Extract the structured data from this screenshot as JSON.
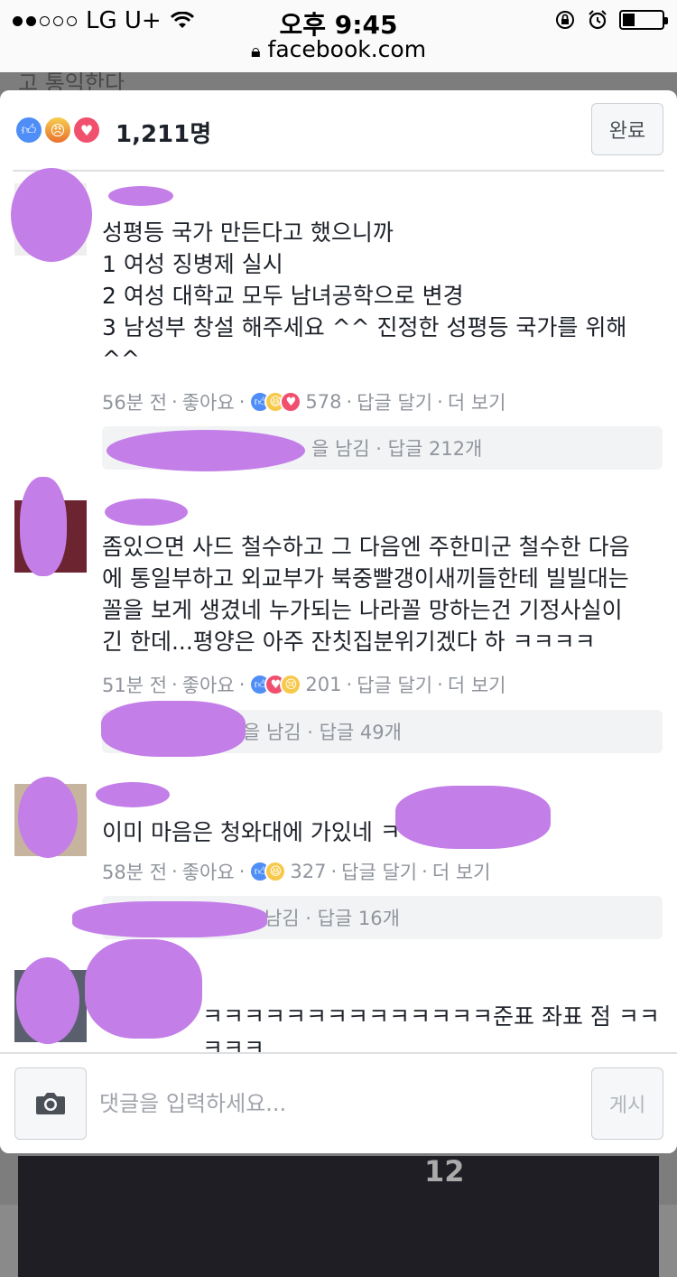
{
  "status_bar": {
    "carrier": "LG U+",
    "time": "오후 9:45",
    "url": "facebook.com",
    "battery_level": 0.3
  },
  "background_page": {
    "top_text": "고 통익한다",
    "photo_number": "12"
  },
  "header": {
    "reaction_icons": [
      "like-icon",
      "angry-icon",
      "love-icon"
    ],
    "reaction_count": "1,211명",
    "done_label": "완료"
  },
  "comments": [
    {
      "text": "성평등 국가 만든다고 했으니까\n1 여성 징병제 실시\n2 여성 대학교 모두 남녀공학으로 변경\n3 남성부 창설 해주세요 ^^ 진정한 성평등 국가를 위해\n^^",
      "time": "56분 전",
      "like": "좋아요",
      "reactions": [
        "like",
        "haha",
        "love"
      ],
      "reaction_count": "578",
      "reply": "답글 달기",
      "more": "더 보기",
      "replies_summary": "을 남김 · 답글 212개"
    },
    {
      "text": "좀있으면 사드 철수하고 그 다음엔 주한미군 철수한 다음\n에 통일부하고 외교부가 북중빨갱이새끼들한테 빌빌대는\n꼴을 보게 생겼네 누가되는 나라꼴 망하는건 기정사실이\n긴 한데...평양은 아주 잔칫집분위기겠다 하 ㅋㅋㅋㅋ",
      "time": "51분 전",
      "like": "좋아요",
      "reactions": [
        "like",
        "love",
        "sad"
      ],
      "reaction_count": "201",
      "reply": "답글 달기",
      "more": "더 보기",
      "replies_summary": "님이 답글을 남김 · 답글 49개"
    },
    {
      "text": "이미 마음은 청와대에 가있네 ㅋ",
      "time": "58분 전",
      "like": "좋아요",
      "reactions": [
        "like",
        "haha"
      ],
      "reaction_count": "327",
      "reply": "답글 달기",
      "more": "더 보기",
      "replies_summary": "님이 답글을 남김 · 답글 16개"
    },
    {
      "text": "ㅋㅋㅋㅋㅋㅋㅋㅋㅋㅋㅋㅋㅋㅋ준표 좌표 점 ㅋㅋㅋㅋㅋ"
    }
  ],
  "composer": {
    "placeholder": "댓글을 입력하세요...",
    "post_label": "게시"
  }
}
